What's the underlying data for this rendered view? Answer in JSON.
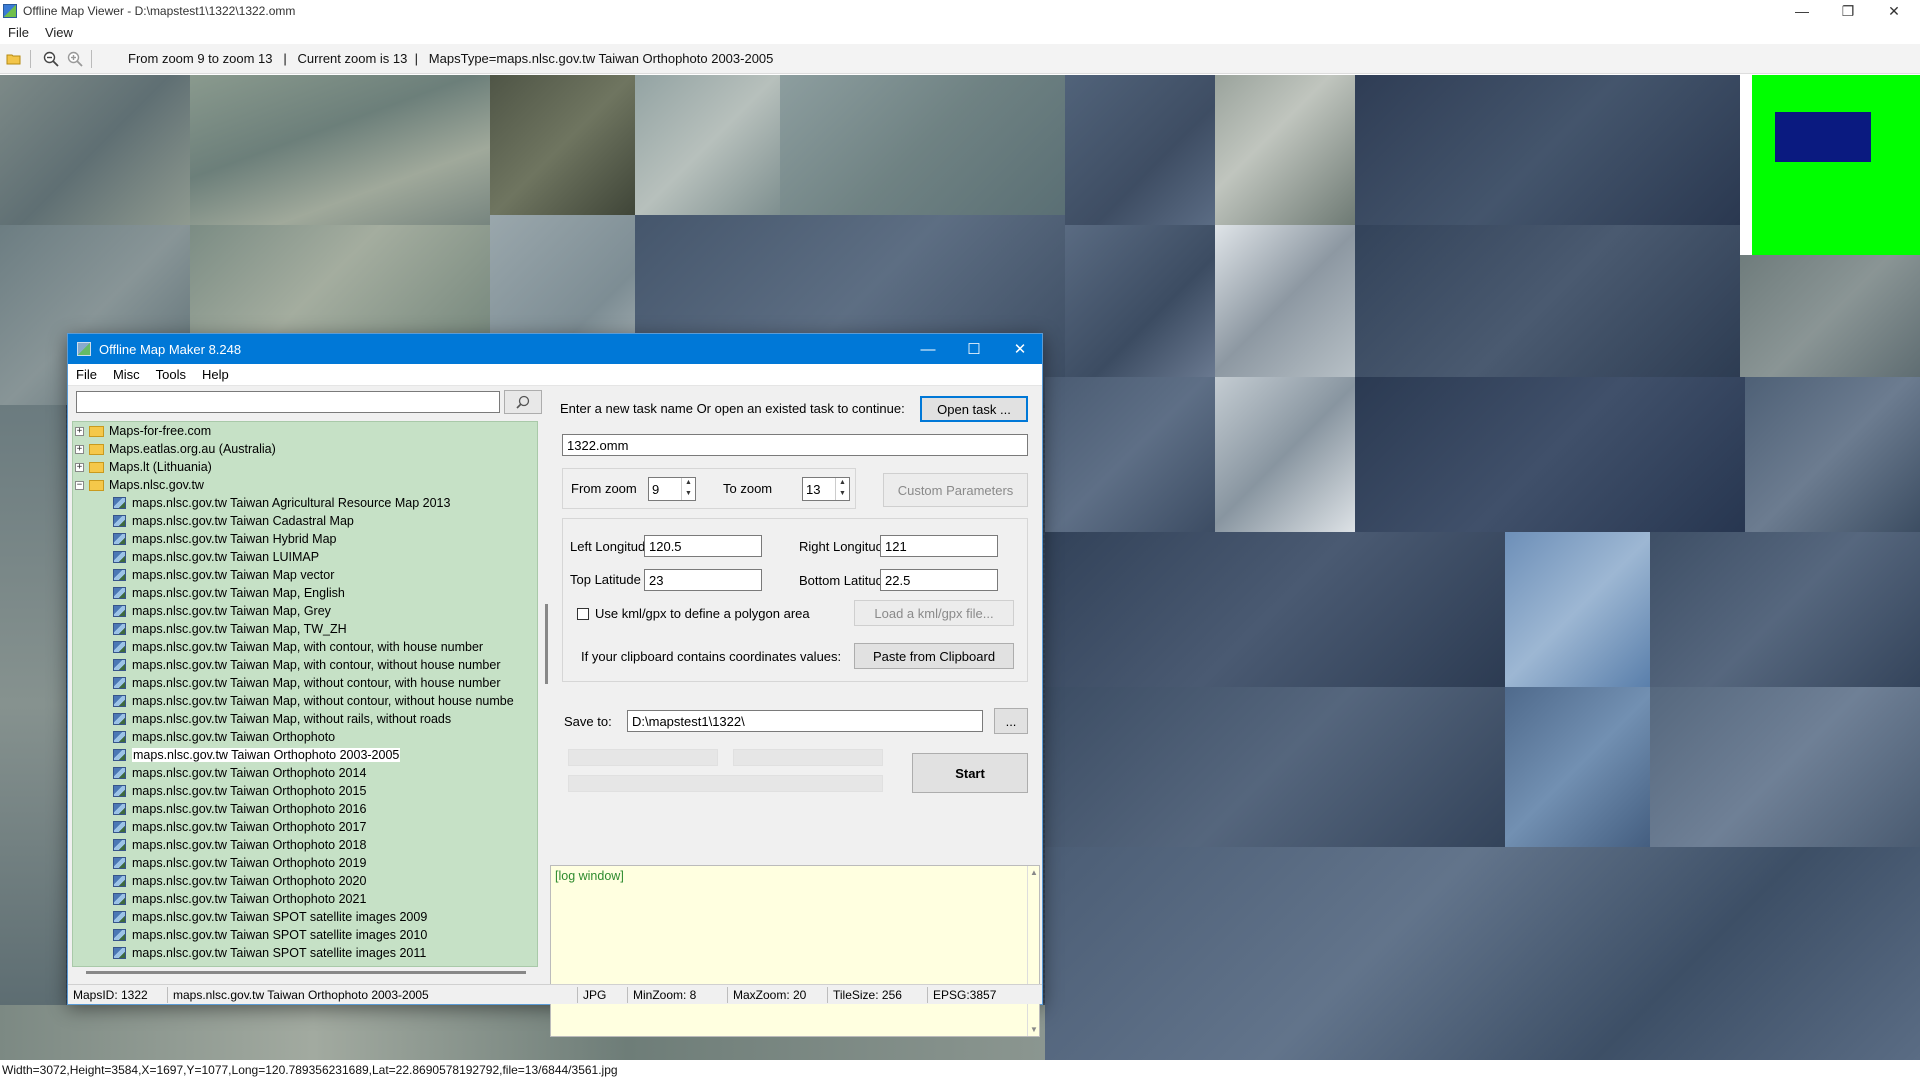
{
  "window": {
    "title": "Offline Map Viewer - D:\\mapstest1\\1322\\1322.omm",
    "controls": [
      "—",
      "❐",
      "✕"
    ]
  },
  "menu": [
    "File",
    "View"
  ],
  "toolbar": {
    "info": "From zoom 9 to zoom 13   |   Current zoom is 13  |   MapsType=maps.nlsc.gov.tw Taiwan Orthophoto 2003-2005"
  },
  "status": {
    "text": "Width=3072,Height=3584,X=1697,Y=1077,Long=120.789356231689,Lat=22.8690578192792,file=13/6844/3561.jpg"
  },
  "dialog": {
    "title": "Offline Map Maker 8.248",
    "menu": [
      "File",
      "Misc",
      "Tools",
      "Help"
    ],
    "search": {
      "value": "",
      "placeholder": ""
    },
    "tree": {
      "folders": [
        {
          "label": "Maps-for-free.com",
          "expander": "+"
        },
        {
          "label": "Maps.eatlas.org.au (Australia)",
          "expander": "+"
        },
        {
          "label": "Maps.lt (Lithuania)",
          "expander": "+"
        },
        {
          "label": "Maps.nlsc.gov.tw",
          "expander": "−"
        }
      ],
      "items": [
        "maps.nlsc.gov.tw Taiwan Agricultural Resource Map 2013",
        "maps.nlsc.gov.tw Taiwan Cadastral Map",
        "maps.nlsc.gov.tw Taiwan Hybrid Map",
        "maps.nlsc.gov.tw Taiwan LUIMAP",
        "maps.nlsc.gov.tw Taiwan Map vector",
        "maps.nlsc.gov.tw Taiwan Map, English",
        "maps.nlsc.gov.tw Taiwan Map, Grey",
        "maps.nlsc.gov.tw Taiwan Map, TW_ZH",
        "maps.nlsc.gov.tw Taiwan Map, with contour, with house number",
        "maps.nlsc.gov.tw Taiwan Map, with contour, without house number",
        "maps.nlsc.gov.tw Taiwan Map, without contour, with house number",
        "maps.nlsc.gov.tw Taiwan Map, without contour, without house numbe",
        "maps.nlsc.gov.tw Taiwan Map, without rails, without roads",
        "maps.nlsc.gov.tw Taiwan Orthophoto",
        "maps.nlsc.gov.tw Taiwan Orthophoto 2003-2005",
        "maps.nlsc.gov.tw Taiwan Orthophoto 2014",
        "maps.nlsc.gov.tw Taiwan Orthophoto 2015",
        "maps.nlsc.gov.tw Taiwan Orthophoto 2016",
        "maps.nlsc.gov.tw Taiwan Orthophoto 2017",
        "maps.nlsc.gov.tw Taiwan Orthophoto 2018",
        "maps.nlsc.gov.tw Taiwan Orthophoto 2019",
        "maps.nlsc.gov.tw Taiwan Orthophoto 2020",
        "maps.nlsc.gov.tw Taiwan Orthophoto 2021",
        "maps.nlsc.gov.tw Taiwan SPOT satellite images 2009",
        "maps.nlsc.gov.tw Taiwan SPOT satellite images 2010",
        "maps.nlsc.gov.tw Taiwan SPOT satellite images 2011"
      ],
      "selected_index": 14
    },
    "task": {
      "prompt": "Enter a new task name Or open an existed task to continue:",
      "open_button": "Open task ...",
      "name_value": "1322.omm"
    },
    "zoom": {
      "from_label": "From zoom",
      "from_value": "9",
      "to_label": "To zoom",
      "to_value": "13",
      "custom_button": "Custom Parameters"
    },
    "area": {
      "left_lon_label": "Left Longitude",
      "left_lon_value": "120.5",
      "right_lon_label": "Right Longitude",
      "right_lon_value": "121",
      "top_lat_label": "Top Latitude",
      "top_lat_value": "23",
      "bottom_lat_label": "Bottom Latitude",
      "bottom_lat_value": "22.5",
      "kml_label": "Use kml/gpx to define a polygon area",
      "kml_checked": false,
      "load_button": "Load a kml/gpx file...",
      "clipboard_label": "If your clipboard contains coordinates values:",
      "paste_button": "Paste from Clipboard"
    },
    "save": {
      "label": "Save to:",
      "value": "D:\\mapstest1\\1322\\",
      "browse_button": "...",
      "start_button": "Start"
    },
    "log": {
      "text": "[log window]"
    },
    "statusbar": {
      "maps_id": "MapsID: 1322",
      "maps_name": "maps.nlsc.gov.tw Taiwan Orthophoto 2003-2005",
      "format": "JPG",
      "min_zoom": "MinZoom: 8",
      "max_zoom": "MaxZoom: 20",
      "tile_size": "TileSize: 256",
      "epsg": "EPSG:3857"
    }
  },
  "colors": {
    "dialog_title": "#0078d7",
    "tree_bg": "#c6e1c6",
    "log_bg": "#ffffe0",
    "minimap_green": "#00ff00",
    "minimap_view": "#0a1a80"
  }
}
